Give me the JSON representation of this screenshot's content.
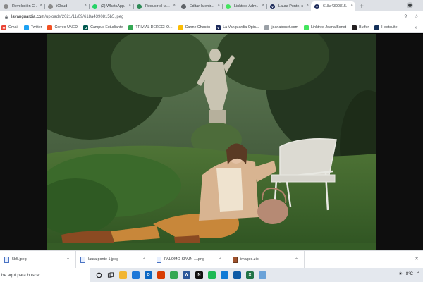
{
  "browser": {
    "tabs": [
      {
        "title": "Revolución C...",
        "favicon": "flag-favicon",
        "color": "#8a8a8a",
        "glyph": ""
      },
      {
        "title": "iCloud",
        "favicon": "apple-favicon",
        "color": "#8a8a8a",
        "glyph": ""
      },
      {
        "title": "(2) WhatsApp...",
        "favicon": "whatsapp-favicon",
        "color": "#25d366",
        "glyph": ""
      },
      {
        "title": "Reducir el ta...",
        "favicon": "reload-favicon",
        "color": "#2e8b57",
        "glyph": ""
      },
      {
        "title": "Editar la entr...",
        "favicon": "doc-favicon",
        "color": "#5f6368",
        "glyph": ""
      },
      {
        "title": "Linktree Adm...",
        "favicon": "linktree-favicon",
        "color": "#43e55e",
        "glyph": ""
      },
      {
        "title": "Laura Ponte, s...",
        "favicon": "vanguardia-favicon",
        "color": "#1c2a5a",
        "glyph": "V"
      },
      {
        "title": "618a4390815...",
        "favicon": "vanguardia-favicon",
        "color": "#1c2a5a",
        "glyph": "V",
        "active": true
      }
    ],
    "new_tab": "+",
    "url_host": "lavanguardia.com",
    "url_path": "/uploads/2021/11/09/618a4390815b5.jpeg",
    "bookmarks": [
      {
        "label": "Gmail",
        "icon": "gmail-icon",
        "color": "#ea4335",
        "glyph": "M"
      },
      {
        "label": "Twitter",
        "icon": "twitter-icon",
        "color": "#1da1f2",
        "glyph": ""
      },
      {
        "label": "Correo UNED",
        "icon": "microsoft-icon",
        "color": "#f25022",
        "glyph": ""
      },
      {
        "label": "Campus Estudiante",
        "icon": "uned-icon",
        "color": "#00594f",
        "glyph": "U"
      },
      {
        "label": "TRIVIAL DERECHO...",
        "icon": "drive-icon",
        "color": "#34a853",
        "glyph": ""
      },
      {
        "label": "Carme Chacón",
        "icon": "drive-icon",
        "color": "#fbbc04",
        "glyph": ""
      },
      {
        "label": "La Vanguardia Opin...",
        "icon": "vanguardia-icon",
        "color": "#1c2a5a",
        "glyph": "V"
      },
      {
        "label": "joanabonet.com",
        "icon": "globe-icon",
        "color": "#9aa0a6",
        "glyph": ""
      },
      {
        "label": "Linktree Joana Bonet",
        "icon": "linktree-icon",
        "color": "#43e55e",
        "glyph": ""
      },
      {
        "label": "Buffer",
        "icon": "buffer-icon",
        "color": "#231f20",
        "glyph": ""
      },
      {
        "label": "Hootsuite",
        "icon": "hootsuite-icon",
        "color": "#143059",
        "glyph": ""
      }
    ]
  },
  "downloads": [
    {
      "name": "5b5.jpeg",
      "icon": "image-file-icon"
    },
    {
      "name": "laura ponte 1.jpeg",
      "icon": "image-file-icon"
    },
    {
      "name": "PALOMO-SPAIN-....png",
      "icon": "image-file-icon"
    },
    {
      "name": "images.zip",
      "icon": "zip-file-icon"
    }
  ],
  "taskbar": {
    "search_text": "be aquí para buscar",
    "apps": [
      {
        "name": "file-explorer-icon",
        "color": "#f2b632",
        "glyph": ""
      },
      {
        "name": "mail-icon",
        "color": "#1e78d8",
        "glyph": ""
      },
      {
        "name": "outlook-icon",
        "color": "#0a66c2",
        "glyph": "O"
      },
      {
        "name": "office-icon",
        "color": "#d83b01",
        "glyph": ""
      },
      {
        "name": "chrome-icon",
        "color": "#34a853",
        "glyph": ""
      },
      {
        "name": "word-icon",
        "color": "#2b579a",
        "glyph": "W"
      },
      {
        "name": "netflix-icon",
        "color": "#111111",
        "glyph": "N"
      },
      {
        "name": "spotify-icon",
        "color": "#1db954",
        "glyph": ""
      },
      {
        "name": "edge-icon",
        "color": "#0f7ad6",
        "glyph": ""
      },
      {
        "name": "photos-icon",
        "color": "#0c5aa6",
        "glyph": ""
      },
      {
        "name": "excel-icon",
        "color": "#217346",
        "glyph": "X"
      },
      {
        "name": "paint-icon",
        "color": "#6aa2d8",
        "glyph": ""
      }
    ],
    "weather": "8°C"
  }
}
